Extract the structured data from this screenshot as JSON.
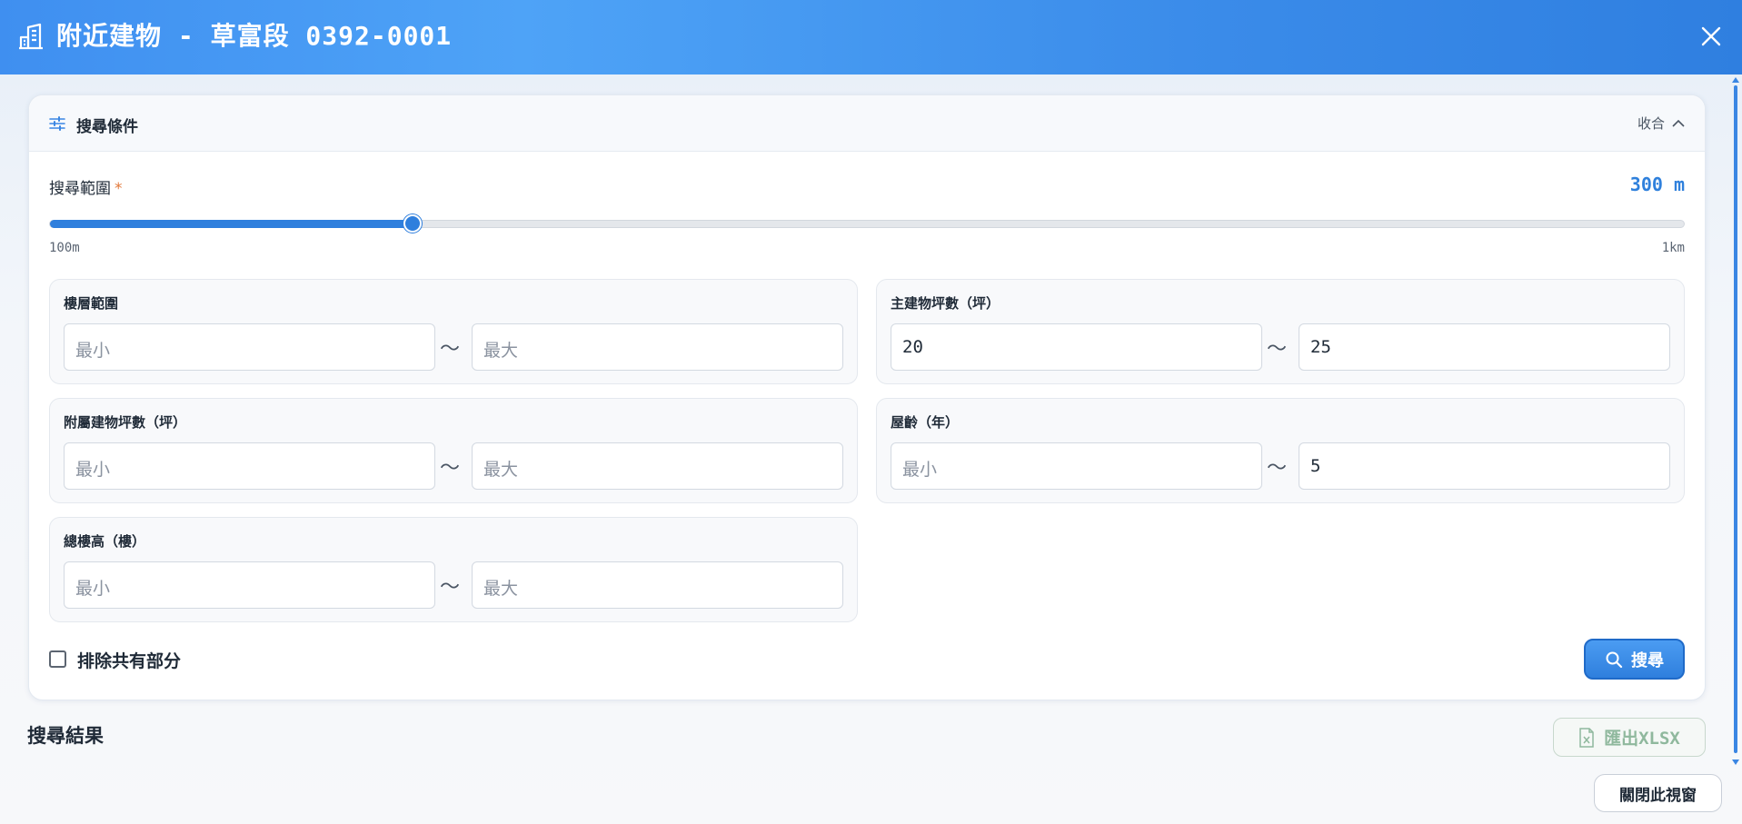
{
  "header": {
    "title": "附近建物 - 草富段 0392-0001",
    "close_icon": "close-icon",
    "building_icon": "building-icon"
  },
  "panel": {
    "title": "搜尋條件",
    "collapse_label": "收合",
    "range": {
      "label": "搜尋範圍",
      "required_mark": "*",
      "value_text": "300 m",
      "min_label": "100m",
      "max_label": "1km",
      "fraction": 0.222
    },
    "groups": [
      {
        "label": "樓層範圍",
        "min_value": "",
        "max_value": "",
        "min_placeholder": "最小",
        "max_placeholder": "最大"
      },
      {
        "label": "主建物坪數（坪）",
        "min_value": "20",
        "max_value": "25",
        "min_placeholder": "最小",
        "max_placeholder": "最大"
      },
      {
        "label": "附屬建物坪數（坪）",
        "min_value": "",
        "max_value": "",
        "min_placeholder": "最小",
        "max_placeholder": "最大"
      },
      {
        "label": "屋齡（年）",
        "min_value": "",
        "max_value": "5",
        "min_placeholder": "最小",
        "max_placeholder": "最大"
      },
      {
        "label": "總樓高（樓）",
        "min_value": "",
        "max_value": "",
        "min_placeholder": "最小",
        "max_placeholder": "最大"
      }
    ],
    "range_separator": "～",
    "exclude_shared_label": "排除共有部分",
    "exclude_shared_checked": false,
    "search_button_label": "搜尋"
  },
  "results": {
    "title": "搜尋結果",
    "export_label": "匯出XLSX"
  },
  "footer": {
    "close_window_label": "關閉此視窗"
  },
  "colors": {
    "header_blue": "#3f8ff0",
    "accent": "#2f7fdd",
    "required": "#e2783a",
    "export_green": "#8fb89d"
  }
}
